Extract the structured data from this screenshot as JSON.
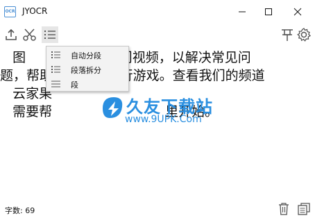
{
  "window": {
    "app_icon_text": "OCR",
    "title": "JYOCR"
  },
  "toolbar": {
    "upload_icon": "upload-icon",
    "cut_icon": "scissors-icon",
    "format_icon": "list-format-icon",
    "pin_icon": "pin-icon",
    "settings_icon": "gear-icon"
  },
  "content": {
    "lines": [
      "   图                非入门视频，以解决常见问",
      "题，帮助                行游戏。查看我们的频道",
      "   云家果",
      "   需要帮                           里开始。"
    ]
  },
  "menu": {
    "items": [
      {
        "label": "自动分段"
      },
      {
        "label": "段落拆分"
      },
      {
        "label": "段"
      }
    ]
  },
  "watermark": {
    "name": "久友下载站",
    "url": "www.9UPK.Com"
  },
  "status": {
    "count_text": "字数: 69"
  },
  "colors": {
    "accent": "#2a8fe0",
    "icon": "#555555"
  }
}
